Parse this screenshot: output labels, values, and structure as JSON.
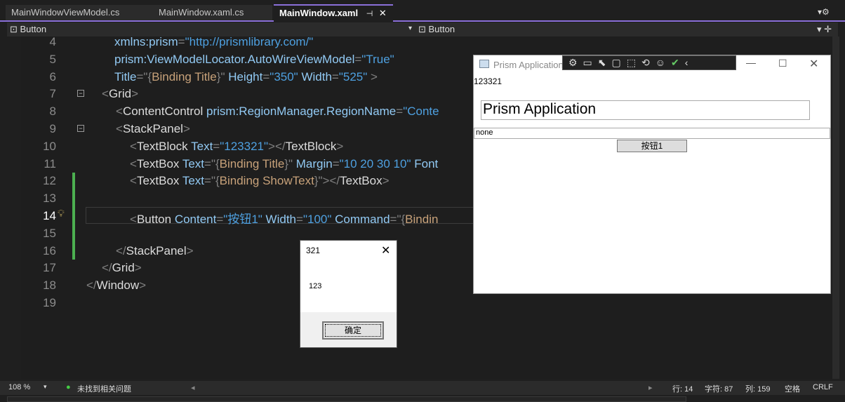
{
  "tabs": [
    {
      "label": "MainWindowViewModel.cs"
    },
    {
      "label": "MainWindow.xaml.cs"
    },
    {
      "label": "MainWindow.xaml"
    }
  ],
  "nav": {
    "left": "Button",
    "right": "Button"
  },
  "code": [
    {
      "n": "4",
      "indent": 163,
      "t": [
        [
          "a",
          "xmlns:prism"
        ],
        [
          "b",
          "="
        ],
        [
          "q",
          "\"http://prismlibrary.com/\""
        ]
      ]
    },
    {
      "n": "5",
      "indent": 163,
      "t": [
        [
          "a",
          "prism:ViewModelLocator.AutoWireViewModel"
        ],
        [
          "b",
          "="
        ],
        [
          "q",
          "\"True\""
        ]
      ]
    },
    {
      "n": "6",
      "indent": 163,
      "t": [
        [
          "a",
          "Title"
        ],
        [
          "b",
          "=\"{"
        ],
        [
          "m",
          "Binding Title"
        ],
        [
          "b",
          "}\" "
        ],
        [
          "a",
          "Height"
        ],
        [
          "b",
          "="
        ],
        [
          "q",
          "\"350\" "
        ],
        [
          "a",
          "Width"
        ],
        [
          "b",
          "="
        ],
        [
          "q",
          "\"525\""
        ],
        [
          "b",
          " >"
        ]
      ]
    },
    {
      "n": "7",
      "indent": 145,
      "t": [
        [
          "b",
          "<"
        ],
        [
          "e",
          "Grid"
        ],
        [
          "b",
          ">"
        ]
      ]
    },
    {
      "n": "8",
      "indent": 165,
      "t": [
        [
          "b",
          "<"
        ],
        [
          "e",
          "ContentControl "
        ],
        [
          "a",
          "prism:RegionManager.RegionName"
        ],
        [
          "b",
          "="
        ],
        [
          "q",
          "\"Conte"
        ]
      ]
    },
    {
      "n": "9",
      "indent": 165,
      "t": [
        [
          "b",
          "<"
        ],
        [
          "e",
          "StackPanel"
        ],
        [
          "b",
          ">"
        ]
      ]
    },
    {
      "n": "10",
      "indent": 185,
      "t": [
        [
          "b",
          "<"
        ],
        [
          "e",
          "TextBlock "
        ],
        [
          "a",
          "Text"
        ],
        [
          "b",
          "="
        ],
        [
          "q",
          "\"123321\""
        ],
        [
          "b",
          ">"
        ],
        [
          "b",
          "</"
        ],
        [
          "e",
          "TextBlock"
        ],
        [
          "b",
          ">"
        ]
      ]
    },
    {
      "n": "11",
      "indent": 185,
      "t": [
        [
          "b",
          "<"
        ],
        [
          "e",
          "TextBox "
        ],
        [
          "a",
          "Text"
        ],
        [
          "b",
          "=\"{"
        ],
        [
          "m",
          "Binding Title"
        ],
        [
          "b",
          "}\" "
        ],
        [
          "a",
          "Margin"
        ],
        [
          "b",
          "="
        ],
        [
          "q",
          "\"10 20 30 10\" "
        ],
        [
          "a",
          "Font"
        ]
      ]
    },
    {
      "n": "12",
      "indent": 185,
      "t": [
        [
          "b",
          "<"
        ],
        [
          "e",
          "TextBox "
        ],
        [
          "a",
          "Text"
        ],
        [
          "b",
          "=\"{"
        ],
        [
          "m",
          "Binding ShowText"
        ],
        [
          "b",
          "}\""
        ],
        [
          "b",
          "></"
        ],
        [
          "e",
          "TextBox"
        ],
        [
          "b",
          ">"
        ]
      ]
    },
    {
      "n": "13",
      "indent": 185,
      "t": []
    },
    {
      "n": "14",
      "indent": 185,
      "t": [
        [
          "b",
          "<"
        ],
        [
          "e",
          "Button "
        ],
        [
          "a",
          "Content"
        ],
        [
          "b",
          "="
        ],
        [
          "q",
          "\"按钮1\" "
        ],
        [
          "a",
          "Width"
        ],
        [
          "b",
          "="
        ],
        [
          "q",
          "\"100\" "
        ],
        [
          "a",
          "Command"
        ],
        [
          "b",
          "=\"{"
        ],
        [
          "m",
          "Bindin"
        ]
      ]
    },
    {
      "n": "15",
      "indent": 185,
      "t": []
    },
    {
      "n": "16",
      "indent": 165,
      "t": [
        [
          "b",
          "</"
        ],
        [
          "e",
          "StackPanel"
        ],
        [
          "b",
          ">"
        ]
      ]
    },
    {
      "n": "17",
      "indent": 145,
      "t": [
        [
          "b",
          "</"
        ],
        [
          "e",
          "Grid"
        ],
        [
          "b",
          ">"
        ]
      ]
    },
    {
      "n": "18",
      "indent": 123,
      "t": [
        [
          "b",
          "</"
        ],
        [
          "e",
          "Window"
        ],
        [
          "b",
          ">"
        ]
      ]
    },
    {
      "n": "19",
      "indent": 123,
      "t": []
    }
  ],
  "status": {
    "zoom": "108 %",
    "issues": "未找到相关问题",
    "line": "行: 14",
    "char": "字符: 87",
    "col": "列: 159",
    "space": "空格",
    "eol": "CRLF"
  },
  "prism": {
    "title": "Prism Application",
    "textblock": "123321",
    "textbox1": "Prism Application",
    "textbox2": "none",
    "button": "按钮1"
  },
  "dialog": {
    "title": "321",
    "message": "123",
    "ok": "确定"
  }
}
